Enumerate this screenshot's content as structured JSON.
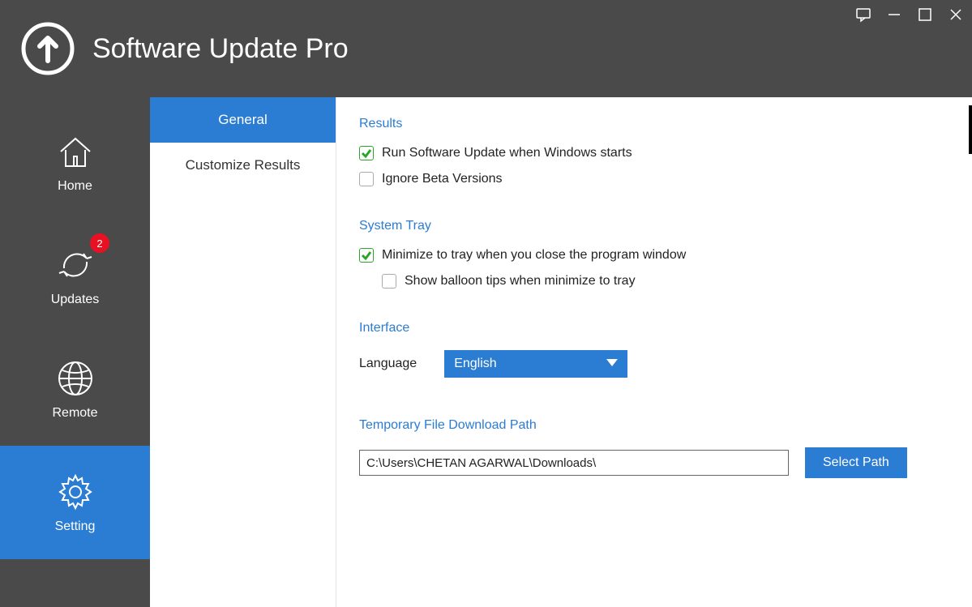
{
  "app": {
    "title": "Software Update Pro"
  },
  "sidebar": {
    "items": [
      {
        "label": "Home"
      },
      {
        "label": "Updates",
        "badge": "2"
      },
      {
        "label": "Remote"
      },
      {
        "label": "Setting"
      }
    ]
  },
  "subnav": {
    "items": [
      {
        "label": "General"
      },
      {
        "label": "Customize Results"
      }
    ]
  },
  "sections": {
    "results": {
      "title": "Results",
      "opt_run_on_start": "Run Software Update when Windows starts",
      "opt_ignore_beta": "Ignore Beta Versions"
    },
    "system_tray": {
      "title": "System Tray",
      "opt_minimize": "Minimize to tray when you close the program window",
      "opt_balloon": "Show balloon tips when minimize to tray"
    },
    "interface": {
      "title": "Interface",
      "language_label": "Language",
      "language_value": "English"
    },
    "download_path": {
      "title": "Temporary File Download Path",
      "path_value": "C:\\Users\\CHETAN AGARWAL\\Downloads\\",
      "select_label": "Select Path"
    }
  }
}
